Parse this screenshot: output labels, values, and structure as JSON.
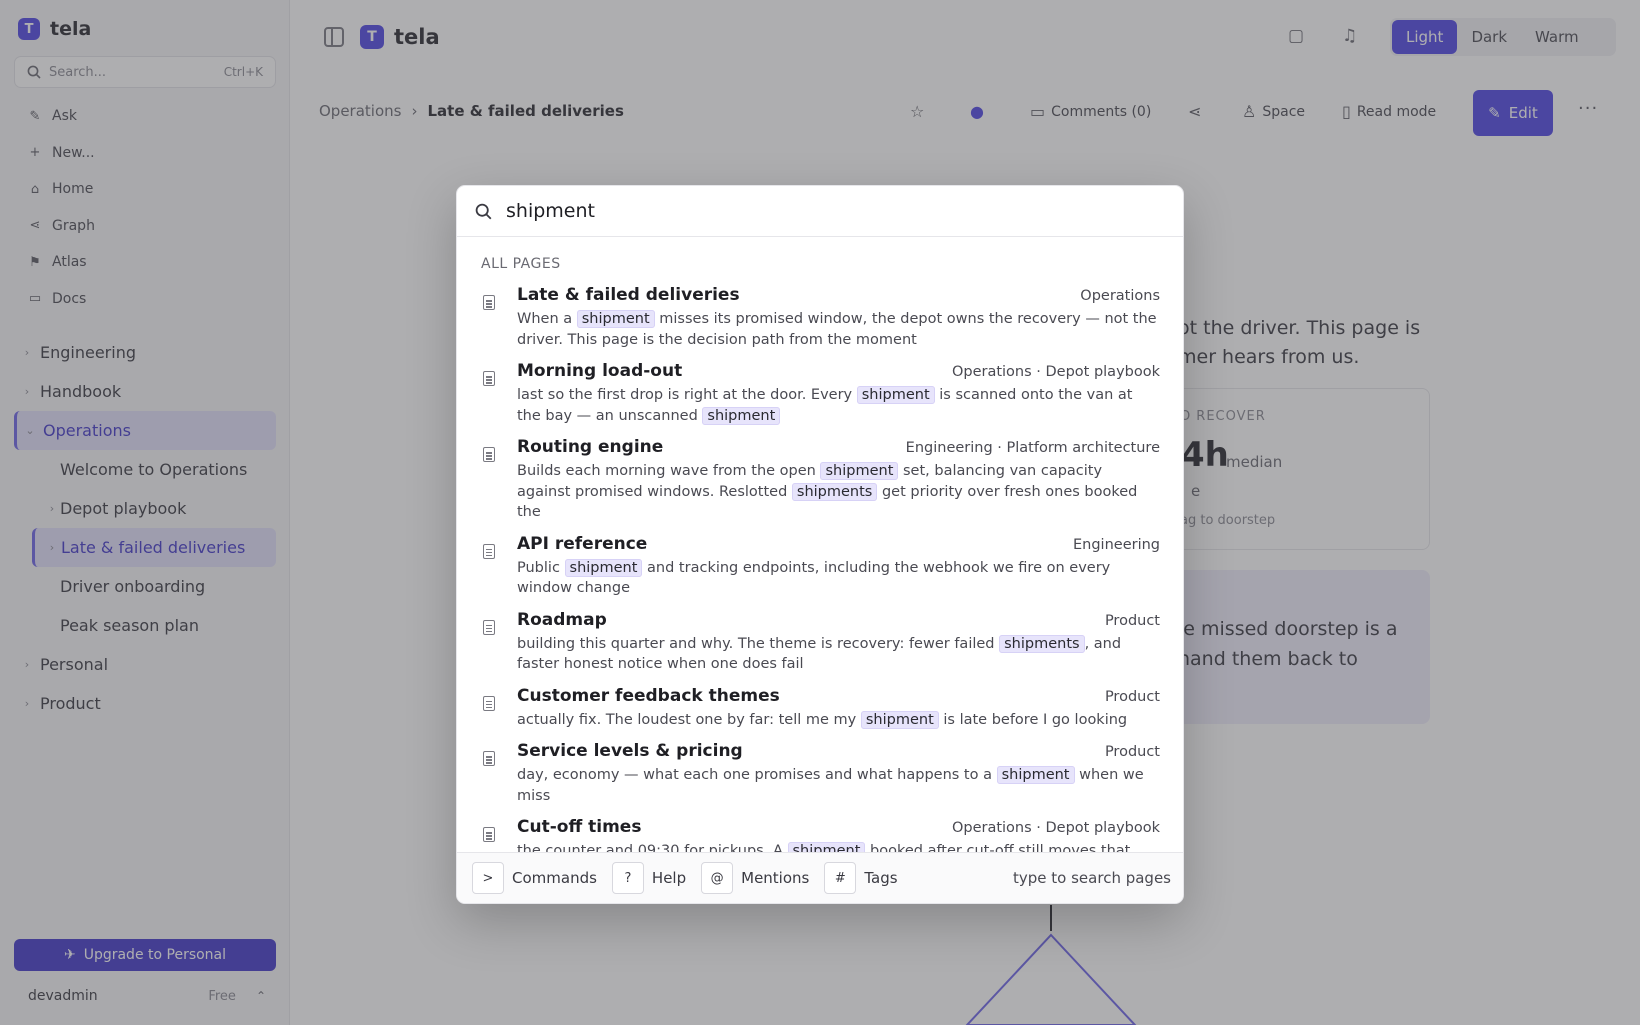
{
  "app": {
    "name": "tela",
    "logo_letter": "T"
  },
  "sidebar": {
    "search_placeholder": "Search...",
    "search_shortcut": "Ctrl+K",
    "nav": [
      {
        "label": "Ask",
        "icon": "sparkle-icon"
      },
      {
        "label": "New...",
        "icon": "plus-icon"
      },
      {
        "label": "Home",
        "icon": "home-icon"
      },
      {
        "label": "Graph",
        "icon": "graph-icon"
      },
      {
        "label": "Atlas",
        "icon": "atlas-icon"
      },
      {
        "label": "Docs",
        "icon": "docs-icon"
      }
    ],
    "tree": [
      {
        "label": "Engineering"
      },
      {
        "label": "Handbook"
      },
      {
        "label": "Operations",
        "active": true
      },
      {
        "label": "Welcome to Operations"
      },
      {
        "label": "Depot playbook"
      },
      {
        "label": "Late & failed deliveries",
        "active": true
      },
      {
        "label": "Driver onboarding"
      },
      {
        "label": "Peak season plan"
      },
      {
        "label": "Personal"
      },
      {
        "label": "Product"
      }
    ],
    "upgrade_label": "Upgrade to Personal",
    "user": {
      "name": "devadmin",
      "plan": "Free"
    }
  },
  "topbar": {
    "themes": [
      "Light",
      "Dark",
      "Warm"
    ],
    "active_theme": "Light"
  },
  "breadcrumb": {
    "parent": "Operations",
    "current": "Late & failed deliveries"
  },
  "toolbar": {
    "comments_label": "Comments (0)",
    "space_label": "Space",
    "read_mode_label": "Read mode",
    "edit_label": "Edit"
  },
  "page_bg": {
    "line1": "ot the driver. This page is",
    "line2": "mer hears from us.",
    "card_label": "TO RECOVER",
    "card_value": "4h",
    "card_unit": "median",
    "card_line": "e",
    "card_sub": "ag to doorstep",
    "callout_line1": "le missed doorstep is a",
    "callout_line2": "hand them back to"
  },
  "search": {
    "query": "shipment",
    "section_label": "ALL PAGES",
    "results": [
      {
        "title": "Late & failed deliveries",
        "path": "Operations",
        "snippet": [
          {
            "t": "When a "
          },
          {
            "t": "shipment",
            "hl": true
          },
          {
            "t": " misses its promised window, the depot owns the recovery — not the driver. This page is the decision path from the moment"
          }
        ]
      },
      {
        "title": "Morning load-out",
        "path": "Operations · Depot playbook",
        "snippet": [
          {
            "t": "last so the first drop is right at the door. Every "
          },
          {
            "t": "shipment",
            "hl": true
          },
          {
            "t": " is scanned onto the van at the bay — an unscanned "
          },
          {
            "t": "shipment",
            "hl": true
          }
        ]
      },
      {
        "title": "Routing engine",
        "path": "Engineering · Platform architecture",
        "snippet": [
          {
            "t": "Builds each morning wave from the open "
          },
          {
            "t": "shipment",
            "hl": true
          },
          {
            "t": " set, balancing van capacity against promised windows. Reslotted "
          },
          {
            "t": "shipments",
            "hl": true
          },
          {
            "t": " get priority over fresh ones booked the"
          }
        ]
      },
      {
        "title": "API reference",
        "path": "Engineering",
        "snippet": [
          {
            "t": "Public "
          },
          {
            "t": "shipment",
            "hl": true
          },
          {
            "t": " and tracking endpoints, including the webhook we fire on every window change"
          }
        ]
      },
      {
        "title": "Roadmap",
        "path": "Product",
        "snippet": [
          {
            "t": "building this quarter and why. The theme is recovery: fewer failed "
          },
          {
            "t": "shipments",
            "hl": true
          },
          {
            "t": ", and faster honest notice when one does fail"
          }
        ]
      },
      {
        "title": "Customer feedback themes",
        "path": "Product",
        "snippet": [
          {
            "t": "actually fix. The loudest one by far: tell me my "
          },
          {
            "t": "shipment",
            "hl": true
          },
          {
            "t": " is late before I go looking"
          }
        ]
      },
      {
        "title": "Service levels & pricing",
        "path": "Product",
        "snippet": [
          {
            "t": "day, economy — what each one promises and what happens to a "
          },
          {
            "t": "shipment",
            "hl": true
          },
          {
            "t": " when we miss"
          }
        ]
      },
      {
        "title": "Cut-off times",
        "path": "Operations · Depot playbook",
        "snippet": [
          {
            "t": "the counter and 09:30 for pickups. A "
          },
          {
            "t": "shipment",
            "hl": true
          },
          {
            "t": " booked after cut-off still moves that day if the depot"
          }
        ]
      }
    ],
    "footer": {
      "keys": [
        {
          "key": ">",
          "label": "Commands"
        },
        {
          "key": "?",
          "label": "Help"
        },
        {
          "key": "@",
          "label": "Mentions"
        },
        {
          "key": "#",
          "label": "Tags"
        }
      ],
      "hint": "type to search pages"
    }
  }
}
